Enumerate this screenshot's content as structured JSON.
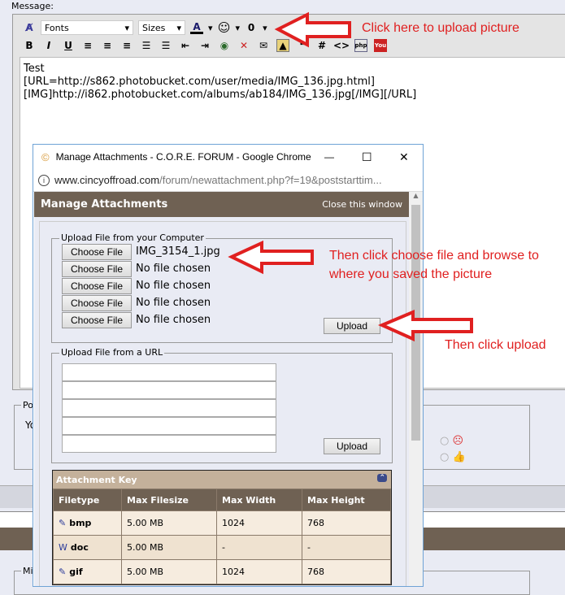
{
  "editor": {
    "label": "Message:",
    "font_select": "Fonts",
    "size_select": "Sizes",
    "text_lines": [
      "Test",
      "",
      "",
      "[URL=http://s862.photobucket.com/user/media/IMG_136.jpg.html]",
      "[IMG]http://i862.photobucket.com/albums/ab184/IMG_136.jpg[/IMG][/URL]"
    ]
  },
  "background": {
    "fieldset1_label": "Po",
    "fieldset1_text": "Yo",
    "fieldset2_label": "Mi"
  },
  "window": {
    "title": "Manage Attachments - C.O.R.E. FORUM - Google Chrome",
    "url_domain": "www.cincyoffroad.com",
    "url_path": "/forum/newattachment.php?f=19&poststarttim..."
  },
  "manage": {
    "title": "Manage Attachments",
    "close": "Close this window",
    "computer_legend": "Upload File from your Computer",
    "choose_label": "Choose File",
    "files": [
      "IMG_3154_1.jpg",
      "No file chosen",
      "No file chosen",
      "No file chosen",
      "No file chosen"
    ],
    "upload_label": "Upload",
    "url_legend": "Upload File from a URL"
  },
  "key": {
    "title": "Attachment Key",
    "headers": [
      "Filetype",
      "Max Filesize",
      "Max Width",
      "Max Height"
    ],
    "rows": [
      [
        "bmp",
        "5.00 MB",
        "1024",
        "768"
      ],
      [
        "doc",
        "5.00 MB",
        "-",
        "-"
      ],
      [
        "gif",
        "5.00 MB",
        "1024",
        "768"
      ]
    ]
  },
  "annotations": {
    "a1": "Click here to upload picture",
    "a2_line1": "Then click choose file and browse to",
    "a2_line2": "where you saved the picture",
    "a3": "Then click upload",
    "color": "#e02020"
  }
}
